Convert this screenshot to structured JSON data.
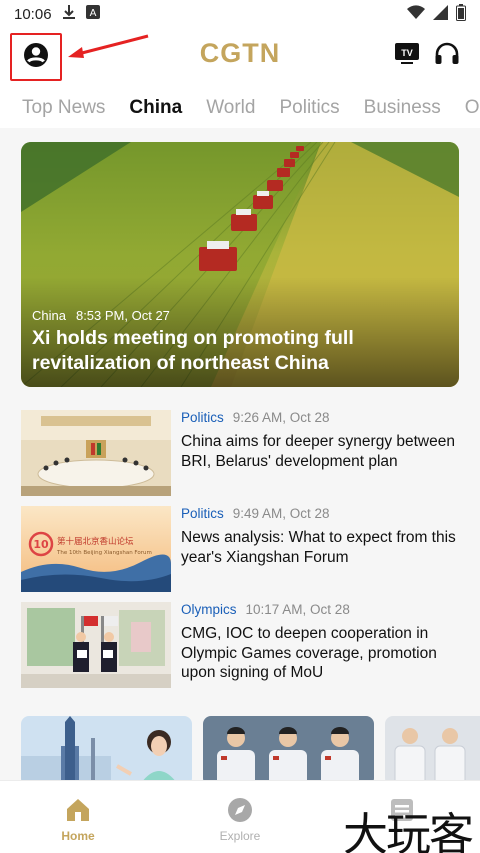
{
  "status": {
    "time": "10:06"
  },
  "header": {
    "logo": "CGTN",
    "profile_icon": "account-circle-icon",
    "tv_icon": "tv-icon",
    "audio_icon": "headphones-icon"
  },
  "tabs": [
    {
      "label": "Top News",
      "active": false
    },
    {
      "label": "China",
      "active": true
    },
    {
      "label": "World",
      "active": false
    },
    {
      "label": "Politics",
      "active": false
    },
    {
      "label": "Business",
      "active": false
    },
    {
      "label": "Op",
      "active": false
    }
  ],
  "hero": {
    "category": "China",
    "time": "8:53 PM, Oct 27",
    "title": "Xi holds meeting on promoting full revitalization of northeast China"
  },
  "news": [
    {
      "category": "Politics",
      "time": "9:26 AM, Oct 28",
      "title": "China aims for deeper synergy between BRI, Belarus' development plan"
    },
    {
      "category": "Politics",
      "time": "9:49 AM, Oct 28",
      "title": "News analysis: What to expect from this year's Xiangshan Forum",
      "thumb_text_cn": "第十届北京香山论坛",
      "thumb_text_en": "The 10th Beijing Xiangshan Forum"
    },
    {
      "category": "Olympics",
      "time": "10:17 AM, Oct 28",
      "title": "CMG, IOC to deepen cooperation in Olympic Games coverage, promotion upon signing of MoU"
    }
  ],
  "bottom_nav": [
    {
      "label": "Home",
      "icon": "home-icon",
      "active": true
    },
    {
      "label": "Explore",
      "icon": "compass-icon",
      "active": false
    },
    {
      "label": "",
      "icon": "list-icon",
      "active": false
    }
  ],
  "watermark": "大玩客",
  "colors": {
    "brand": "#c4a55d",
    "category": "#1a5fb8",
    "highlight": "#e52222"
  }
}
